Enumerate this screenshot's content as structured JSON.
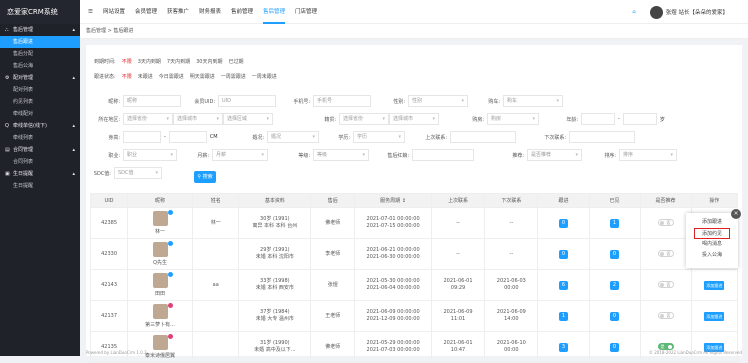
{
  "sidebar": {
    "logo": "恋爱家CRM系统",
    "groups": [
      {
        "icon": "⛬",
        "label": "售后管理",
        "items": [
          "售后跟进",
          "售后分配",
          "售后公海"
        ]
      },
      {
        "icon": "⚙",
        "label": "配对管理",
        "items": [
          "配对列表",
          "约见列表",
          "牵线配对"
        ]
      },
      {
        "icon": "Q",
        "label": "牵线单信(线下)",
        "items": [
          "牵线列表"
        ]
      },
      {
        "icon": "▤",
        "label": "合同管理",
        "items": [
          "合同列表"
        ]
      },
      {
        "icon": "▣",
        "label": "生日提醒",
        "items": [
          "生日提醒"
        ]
      }
    ]
  },
  "header": {
    "menu": [
      "网站设置",
      "会员管理",
      "获客推广",
      "财务报表",
      "售前管理",
      "售后管理",
      "门店管理"
    ],
    "active": "售后管理",
    "user": "张煜 站长【朵朵的爱家】"
  },
  "breadcrumb": "售后管理 > 售后跟进",
  "filters": {
    "row1": {
      "label": "到期时间:",
      "options": [
        "不限",
        "3天内到期",
        "7天内到期",
        "30天内到期",
        "已过期"
      ]
    },
    "row2": {
      "label": "跟进状态:",
      "options": [
        "不限",
        "未跟进",
        "今日需跟进",
        "明天需跟进",
        "一周需跟进",
        "一周未跟进"
      ]
    },
    "nickname": {
      "label": "昵称:",
      "ph": "昵称"
    },
    "uid": {
      "label": "会员UID:",
      "ph": "UID"
    },
    "phone": {
      "label": "手机号:",
      "ph": "手机号"
    },
    "gender": {
      "label": "性别:",
      "ph": "性别"
    },
    "car": {
      "label": "购车:",
      "ph": "购车"
    },
    "region": {
      "label": "所在地区:",
      "a": "选择省份",
      "b": "选择城市",
      "c": "选择区域"
    },
    "hometown": {
      "label": "籍贯:",
      "a": "选择省份",
      "b": "选择城市"
    },
    "house": {
      "label": "购房:",
      "ph": "购房"
    },
    "age": {
      "label": "年龄:",
      "sep": "-",
      "unit": "岁"
    },
    "height": {
      "label": "身高:",
      "sep": "-",
      "unit": "CM"
    },
    "marriage": {
      "label": "婚况:",
      "ph": "婚况"
    },
    "edu": {
      "label": "学历:",
      "ph": "学历"
    },
    "lastc": {
      "label": "上次联系:"
    },
    "nextc": {
      "label": "下次联系:"
    },
    "job": {
      "label": "职业:",
      "ph": "职业"
    },
    "income": {
      "label": "月薪:",
      "ph": "月薪"
    },
    "level": {
      "label": "等级:",
      "ph": "等级"
    },
    "note": {
      "label": "售后红娘:"
    },
    "recommend": {
      "label": "推荐:",
      "ph": "是否推荐"
    },
    "sort": {
      "label": "排序:",
      "ph": "排序"
    },
    "sdc": {
      "label": "SDC值:",
      "ph": "SDC值"
    },
    "search_btn": "搜索"
  },
  "table": {
    "headers": [
      "UID",
      "昵称",
      "姓名",
      "基本资料",
      "售后",
      "服务周期 ↕",
      "上次联系",
      "下次联系",
      "跟进",
      "已见",
      "是否推荐",
      "操作"
    ],
    "rows": [
      {
        "uid": "42385",
        "nick": "林一",
        "name": "林一",
        "info1": "30岁 (1991)",
        "info2": "离异 本科 本科 台州",
        "staff": "佛老师",
        "p1": "2021-07-01 00:00:00",
        "p2": "2021-07-15 00:00:00",
        "last1": "--",
        "last2": "",
        "next1": "--",
        "next2": "",
        "follow": "0",
        "seen": "1",
        "rec": "否",
        "op": "添加跟进"
      },
      {
        "uid": "42330",
        "nick": "Q先生",
        "name": "",
        "info1": "29岁 (1991)",
        "info2": "未婚 本科 沈阳市",
        "staff": "李老师",
        "p1": "2021-06-21 00:00:00",
        "p2": "2021-06-30 00:00:00",
        "last1": "--",
        "last2": "",
        "next1": "--",
        "next2": "",
        "follow": "0",
        "seen": "0",
        "rec": "否",
        "op": "添加跟进"
      },
      {
        "uid": "42143",
        "nick": "田田",
        "name": "aa",
        "info1": "33岁 (1998)",
        "info2": "未婚 本科 西安市",
        "staff": "张煜",
        "p1": "2021-05-30 00:00:00",
        "p2": "2021-06-04 00:00:00",
        "last1": "2021-06-01",
        "last2": "09:29",
        "next1": "2021-06-03",
        "next2": "00:00",
        "follow": "6",
        "seen": "2",
        "rec": "否",
        "op": "添加跟进"
      },
      {
        "uid": "42137",
        "nick": "第三萝卜有...",
        "name": "",
        "info1": "37岁 (1984)",
        "info2": "未婚 大专 温州市",
        "staff": "王老师",
        "p1": "2021-06-09 00:00:00",
        "p2": "2021-12-09 00:00:00",
        "last1": "2021-06-09",
        "last2": "11:01",
        "next1": "2021-06-09",
        "next2": "14:00",
        "follow": "1",
        "seen": "0",
        "rec": "否",
        "op": "添加跟进"
      },
      {
        "uid": "42135",
        "nick": "泰米诗俄居翼",
        "name": "",
        "info1": "31岁 (1990)",
        "info2": "未婚 高中及以下...",
        "staff": "佛老师",
        "p1": "2021-05-29 00:00:00",
        "p2": "2021-07-03 00:00:00",
        "last1": "2021-06-01",
        "last2": "10:47",
        "next1": "2021-06-10",
        "next2": "00:00",
        "follow": "3",
        "seen": "0",
        "rec": "是",
        "op": "添加跟进"
      }
    ]
  },
  "popup": {
    "items": [
      "添加跟进",
      "添加约见",
      "喝内消息",
      "投入公海"
    ],
    "close": "×"
  },
  "footer": {
    "left": "Powered by LianDuoCrm 1.0.3",
    "right": "© 2018-2022 LianDuoCrm All Rights Reserved"
  }
}
